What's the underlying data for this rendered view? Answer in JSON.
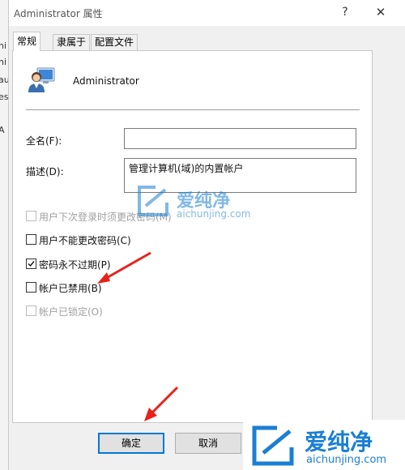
{
  "window": {
    "title": "Administrator 属性",
    "help_icon": "?",
    "close_icon": "✕"
  },
  "tabs": [
    {
      "label": "常规",
      "active": true
    },
    {
      "label": "隶属于",
      "active": false
    },
    {
      "label": "配置文件",
      "active": false
    }
  ],
  "user": {
    "icon": "user-account-icon",
    "name": "Administrator"
  },
  "fields": {
    "fullname": {
      "label": "全名(F):",
      "value": ""
    },
    "description": {
      "label": "描述(D):",
      "value": "管理计算机(域)的内置帐户"
    }
  },
  "checkboxes": [
    {
      "label": "用户下次登录时须更改密码(M)",
      "checked": false,
      "enabled": false
    },
    {
      "label": "用户不能更改密码(C)",
      "checked": false,
      "enabled": true
    },
    {
      "label": "密码永不过期(P)",
      "checked": true,
      "enabled": true
    },
    {
      "label": "帐户已禁用(B)",
      "checked": false,
      "enabled": true
    },
    {
      "label": "帐户已锁定(O)",
      "checked": false,
      "enabled": false
    }
  ],
  "buttons": {
    "ok": "确定",
    "cancel": "取消"
  },
  "watermark": {
    "brand": "爱纯净",
    "url": "aichunjing.com"
  },
  "background_window_fragments": [
    "ni",
    "ni",
    "au",
    "es",
    "A"
  ],
  "colors": {
    "accent": "#0078d7",
    "arrow": "#e8211b",
    "watermark": "#1a7fd4"
  }
}
